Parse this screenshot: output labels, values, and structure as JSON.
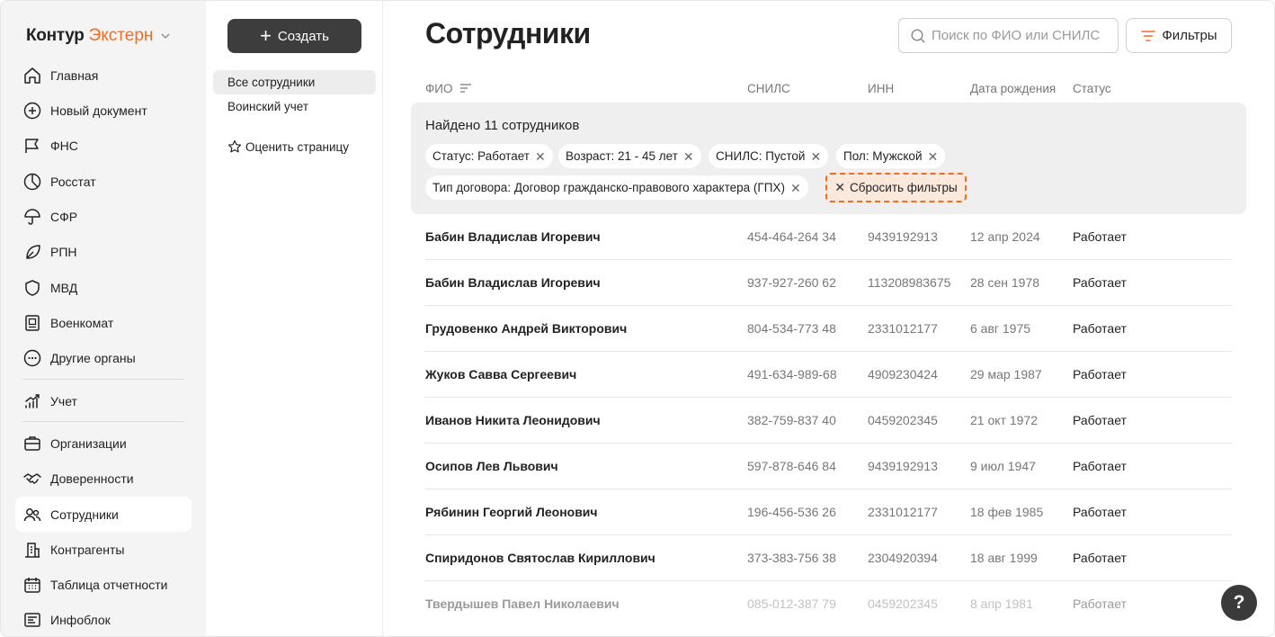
{
  "brand": {
    "part1": "Контур",
    "part2": "Экстерн"
  },
  "nav": {
    "items": [
      {
        "label": "Главная",
        "icon": "home-icon"
      },
      {
        "label": "Новый документ",
        "icon": "plus-circle-icon"
      },
      {
        "label": "ФНС",
        "icon": "flag-icon"
      },
      {
        "label": "Росстат",
        "icon": "pie-chart-icon"
      },
      {
        "label": "СФР",
        "icon": "umbrella-icon"
      },
      {
        "label": "РПН",
        "icon": "leaf-icon"
      },
      {
        "label": "МВД",
        "icon": "shield-icon"
      },
      {
        "label": "Военкомат",
        "icon": "id-card-icon"
      },
      {
        "label": "Другие органы",
        "icon": "more-circle-icon"
      },
      {
        "label": "Учет",
        "icon": "chart-growth-icon"
      },
      {
        "label": "Организации",
        "icon": "briefcase-icon"
      },
      {
        "label": "Доверенности",
        "icon": "handshake-icon"
      },
      {
        "label": "Сотрудники",
        "icon": "people-icon"
      },
      {
        "label": "Контрагенты",
        "icon": "building-icon"
      },
      {
        "label": "Таблица отчетности",
        "icon": "calendar-icon"
      },
      {
        "label": "Инфоблок",
        "icon": "news-icon"
      }
    ],
    "active_index": 12
  },
  "sub": {
    "create_label": "Создать",
    "items": [
      "Все сотрудники",
      "Воинский учет"
    ],
    "rate_label": "Оценить страницу"
  },
  "main": {
    "title": "Сотрудники",
    "search_placeholder": "Поиск по ФИО или СНИЛС",
    "filters_label": "Фильтры",
    "columns": {
      "name": "ФИО",
      "snils": "СНИЛС",
      "inn": "ИНН",
      "birth": "Дата рождения",
      "status": "Статус"
    },
    "found_text": "Найдено 11 сотрудников",
    "chips": [
      "Статус: Работает",
      "Возраст: 21 - 45 лет",
      "СНИЛС: Пустой",
      "Пол: Мужской",
      "Тип договора: Договор гражданско-правового характера (ГПХ)"
    ],
    "reset_label": "Сбросить фильтры",
    "rows": [
      {
        "name": "Бабин Владислав Игоревич",
        "snils": "454-464-264 34",
        "inn": "9439192913",
        "birth": "12 апр 2024",
        "status": "Работает"
      },
      {
        "name": "Бабин Владислав Игоревич",
        "snils": "937-927-260 62",
        "inn": "113208983675",
        "birth": "28 сен 1978",
        "status": "Работает"
      },
      {
        "name": "Грудовенко Андрей Викторович",
        "snils": "804-534-773 48",
        "inn": "2331012177",
        "birth": "6 авг 1975",
        "status": "Работает"
      },
      {
        "name": "Жуков Савва Сергеевич",
        "snils": "491-634-989-68",
        "inn": "4909230424",
        "birth": "29 мар 1987",
        "status": "Работает"
      },
      {
        "name": "Иванов Никита Леонидович",
        "snils": "382-759-837 40",
        "inn": "0459202345",
        "birth": "21 окт 1972",
        "status": "Работает"
      },
      {
        "name": "Осипов Лев Львович",
        "snils": "597-878-646 84",
        "inn": "9439192913",
        "birth": "9 июл 1947",
        "status": "Работает"
      },
      {
        "name": "Рябинин Георгий Леонович",
        "snils": "196-456-536 26",
        "inn": "2331012177",
        "birth": "18 фев 1985",
        "status": "Работает"
      },
      {
        "name": "Спиридонов Святослав Кириллович",
        "snils": "373-383-756 38",
        "inn": "2304920394",
        "birth": "18 авг 1999",
        "status": "Работает"
      },
      {
        "name": "Твердышев Павел Николаевич",
        "snils": "085-012-387 79",
        "inn": "0459202345",
        "birth": "8 апр 1981",
        "status": "Работает"
      }
    ],
    "help_label": "?"
  },
  "colors": {
    "accent": "#f26c27",
    "sidebar_bg": "#f4f4f4",
    "button_dark": "#3d3d3d"
  }
}
